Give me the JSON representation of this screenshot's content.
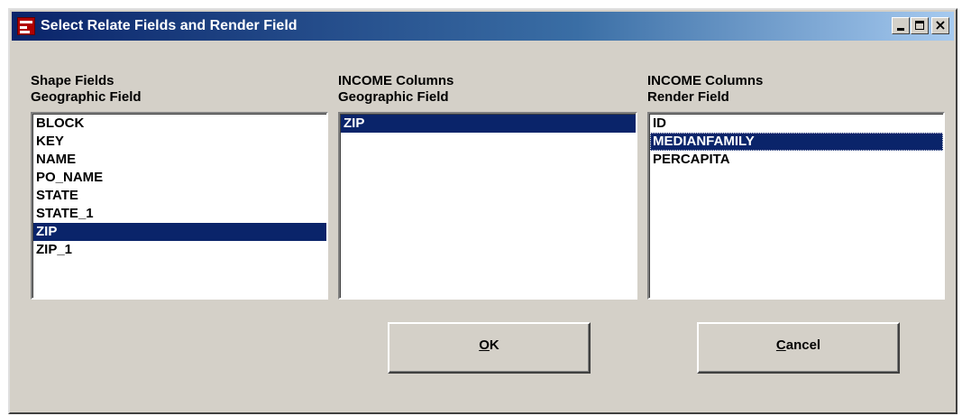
{
  "window": {
    "title": "Select Relate Fields and Render Field",
    "controls": {
      "minimize": "_",
      "maximize": "□",
      "close": "×"
    }
  },
  "columns": [
    {
      "heading": "Shape Fields",
      "subheading": "Geographic Field",
      "items": [
        "BLOCK",
        "KEY",
        "NAME",
        "PO_NAME",
        "STATE",
        "STATE_1",
        "ZIP",
        "ZIP_1"
      ],
      "selected": "ZIP"
    },
    {
      "heading": "INCOME Columns",
      "subheading": "Geographic Field",
      "items": [
        "ZIP"
      ],
      "selected": "ZIP"
    },
    {
      "heading": "INCOME Columns",
      "subheading": "Render Field",
      "items": [
        "ID",
        "MEDIANFAMILY",
        "PERCAPITA"
      ],
      "selected": "MEDIANFAMILY"
    }
  ],
  "buttons": {
    "ok": {
      "mnemonic": "O",
      "rest": "K"
    },
    "cancel": {
      "mnemonic": "C",
      "rest": "ancel"
    }
  },
  "colors": {
    "title_start": "#0a246a",
    "title_end": "#a6caf0",
    "selection": "#0a246a",
    "dialog_face": "#d4d0c8"
  }
}
